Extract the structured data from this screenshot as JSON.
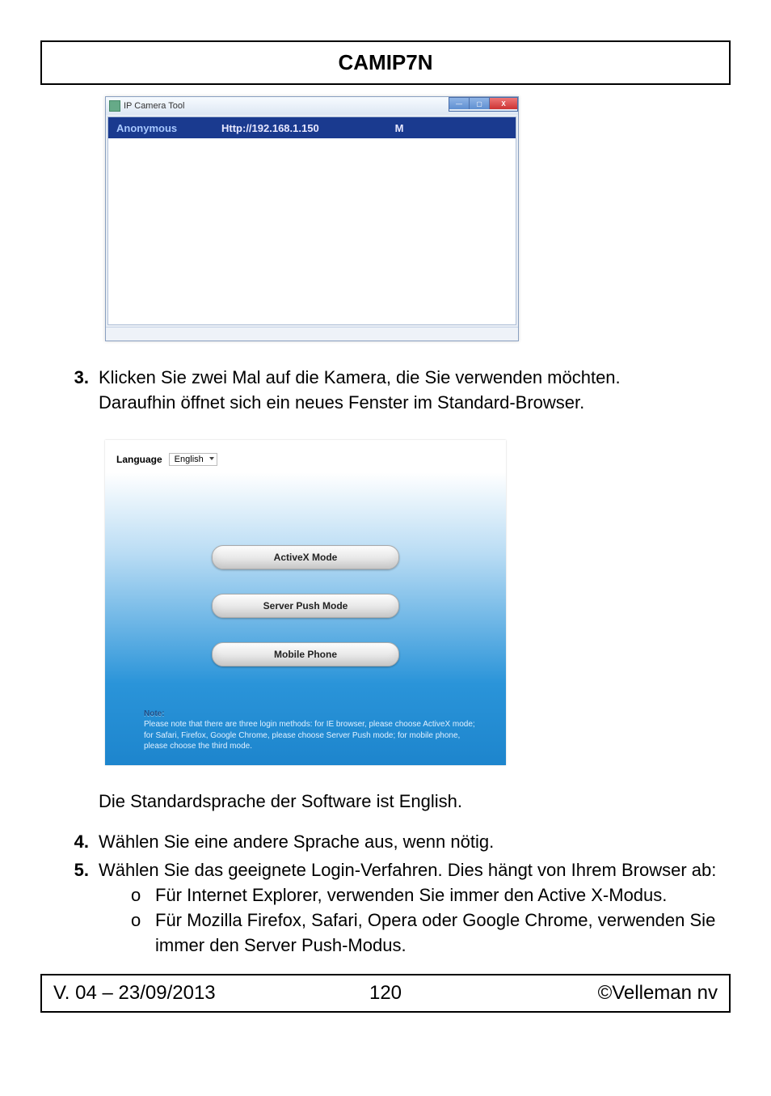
{
  "header": {
    "title": "CAMIP7N"
  },
  "screenshot1": {
    "window_title": "IP Camera Tool",
    "ctrl_min": "—",
    "ctrl_max": "▢",
    "ctrl_close": "X",
    "row": {
      "name": "Anonymous",
      "url": "Http://192.168.1.150",
      "flag": "M"
    }
  },
  "step3": {
    "num": "3.",
    "line1": "Klicken Sie zwei Mal auf die Kamera, die Sie verwenden möchten.",
    "line2": "Daraufhin öffnet sich ein neues Fenster im Standard-Browser."
  },
  "screenshot2": {
    "lang_label": "Language",
    "lang_value": "English",
    "buttons": [
      "ActiveX Mode",
      "Server Push Mode",
      "Mobile Phone"
    ],
    "note_title": "Note:",
    "note_body": "Please note that there are three login methods: for IE browser, please choose ActiveX mode; for Safari, Firefox, Google Chrome, please choose Server Push mode; for mobile phone, please choose the third mode."
  },
  "after_ss2": "Die Standardsprache der Software ist English.",
  "step4": {
    "num": "4.",
    "text": "Wählen Sie eine andere Sprache aus, wenn nötig."
  },
  "step5": {
    "num": "5.",
    "text": "Wählen Sie das geeignete Login-Verfahren. Dies hängt von Ihrem Browser ab:",
    "sub": [
      "Für Internet Explorer, verwenden Sie immer den Active X-Modus.",
      "Für Mozilla Firefox, Safari, Opera oder Google Chrome, verwenden Sie immer den Server Push-Modus."
    ]
  },
  "footer": {
    "left": "V. 04 – 23/09/2013",
    "center": "120",
    "right": "©Velleman nv"
  }
}
